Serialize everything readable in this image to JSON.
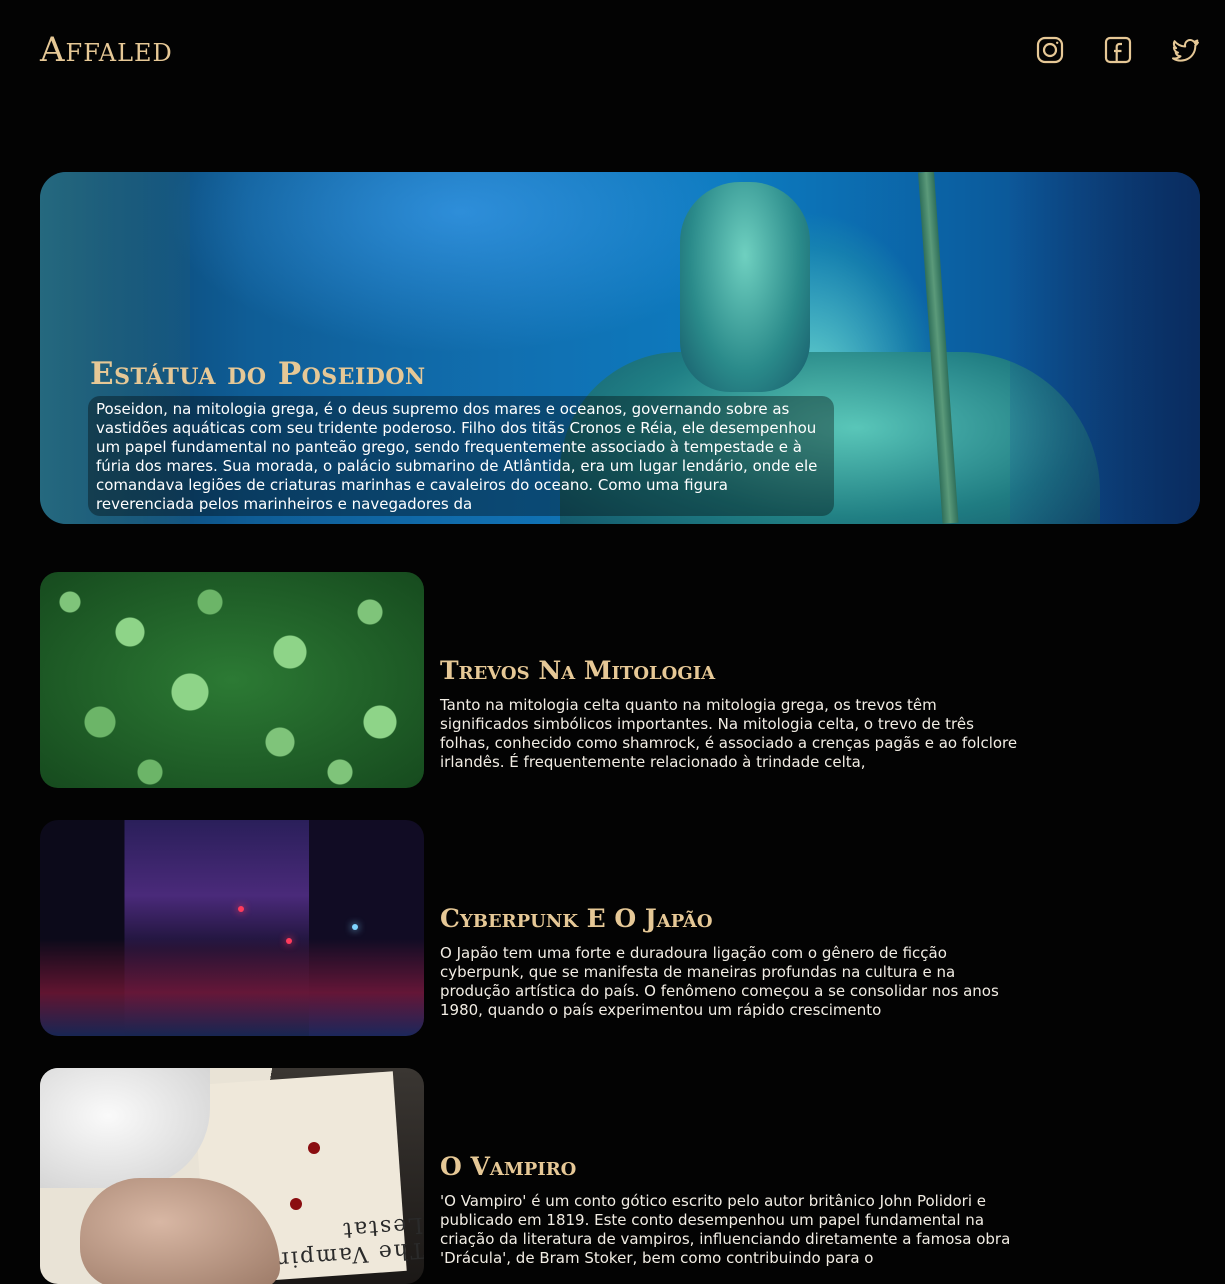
{
  "header": {
    "logo": "Affaled",
    "social": [
      {
        "icon": "instagram-icon"
      },
      {
        "icon": "facebook-icon"
      },
      {
        "icon": "twitter-icon"
      }
    ],
    "accent_color": "#e6c896"
  },
  "hero": {
    "title": "Estátua do Poseidon",
    "text": "Poseidon, na mitologia grega, é o deus supremo dos mares e oceanos, governando sobre as vastidões aquáticas com seu tridente poderoso. Filho dos titãs Cronos e Réia, ele desempenhou um papel fundamental no panteão grego, sendo frequentemente associado à tempestade e à fúria dos mares. Sua morada, o palácio submarino de Atlântida, era um lugar lendário, onde ele comandava legiões de criaturas marinhas e cavaleiros do oceano. Como uma figura reverenciada pelos marinheiros e navegadores da"
  },
  "articles": [
    {
      "title": "Trevos Na Mitologia",
      "text": "Tanto na mitologia celta quanto na mitologia grega, os trevos têm significados simbólicos importantes. Na mitologia celta, o trevo de três folhas, conhecido como shamrock, é associado a crenças pagãs e ao folclore irlandês. É frequentemente relacionado à trindade celta,"
    },
    {
      "title": "Cyberpunk E O Japão",
      "text": "O Japão tem uma forte e duradoura ligação com o gênero de ficção cyberpunk, que se manifesta de maneiras profundas na cultura e na produção artística do país. O fenômeno começou a se consolidar nos anos 1980, quando o país experimentou um rápido crescimento"
    },
    {
      "title": "O Vampiro",
      "text": "'O Vampiro' é um conto gótico escrito pelo autor britânico John Polidori e publicado em 1819. Este conto desempenhou um papel fundamental na criação da literatura de vampiros, influenciando diretamente a famosa obra 'Drácula', de Bram Stoker, bem como contribuindo para o"
    }
  ],
  "book_cover_text": "The Vampire Lestat"
}
